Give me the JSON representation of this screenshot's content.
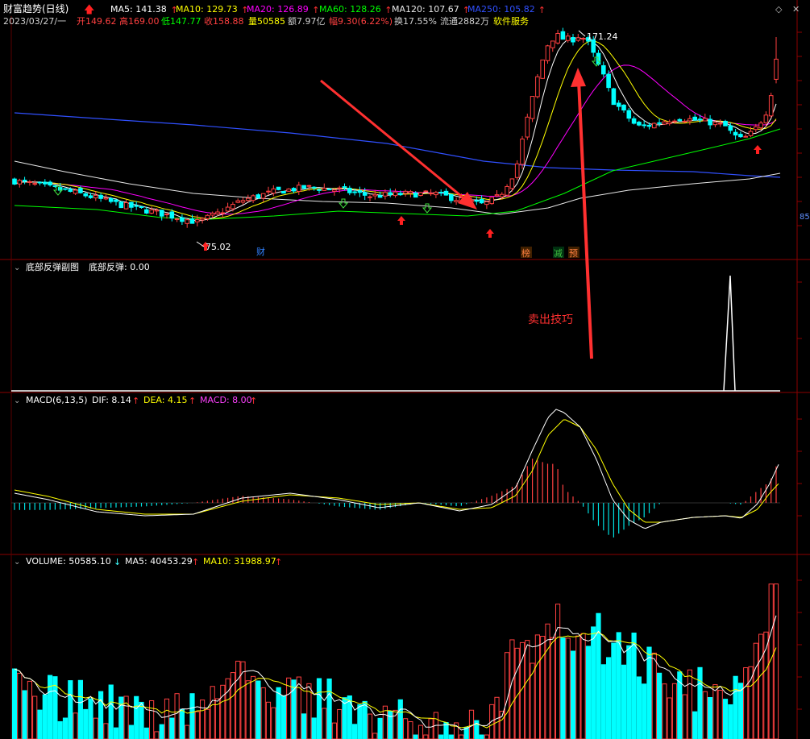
{
  "header": {
    "title": "财富趋势(日线)",
    "ma": [
      {
        "label": "MA5: 141.38",
        "color": "#ffffff"
      },
      {
        "label": "MA10: 129.73",
        "color": "#ffff00"
      },
      {
        "label": "MA20: 126.89",
        "color": "#ff00ff"
      },
      {
        "label": "MA60: 128.26",
        "color": "#00ff00"
      },
      {
        "label": "MA120: 107.67",
        "color": "#e8e8e8"
      },
      {
        "label": "MA250: 105.82",
        "color": "#3050ff"
      }
    ],
    "quote": [
      {
        "text": "2023/03/27/一",
        "color": "#d0d0d0"
      },
      {
        "text": "开149.62",
        "color": "#ff4040"
      },
      {
        "text": "高169.00",
        "color": "#ff4040"
      },
      {
        "text": "低147.77",
        "color": "#00ff00"
      },
      {
        "text": "收158.88",
        "color": "#ff4040"
      },
      {
        "text": "量50585",
        "color": "#ffff00"
      },
      {
        "text": "额7.97亿",
        "color": "#d0d0d0"
      },
      {
        "text": "幅9.30(6.22%)",
        "color": "#ff4040"
      },
      {
        "text": "换17.55%",
        "color": "#d0d0d0"
      },
      {
        "text": "流通2882万",
        "color": "#d0d0d0"
      },
      {
        "text": "软件服务",
        "color": "#ffff00"
      }
    ]
  },
  "annotations": {
    "high_label": "171.24",
    "low_label": "75.02",
    "right_price": "85",
    "sell_label": "卖出技巧",
    "markers": [
      {
        "text": "财",
        "color": "#3080ff"
      },
      {
        "text": "榜",
        "color": "#ff8040"
      },
      {
        "text": "减",
        "color": "#40c040"
      },
      {
        "text": "预",
        "color": "#ff8040"
      }
    ]
  },
  "indicator_panel": {
    "title": "底部反弹副图",
    "value": "底部反弹: 0.00"
  },
  "macd_panel": {
    "title": "MACD(6,13,5)",
    "dif": "DIF: 8.14",
    "dea": "DEA: 4.15",
    "macd": "MACD: 8.00"
  },
  "volume_panel": {
    "volume": "VOLUME: 50585.10",
    "ma5": "MA5: 40453.29",
    "ma10": "MA10: 31988.97"
  },
  "colors": {
    "up": "#ff4040",
    "down": "#00ffff",
    "grid": "#8b0000",
    "ma5": "#ffffff",
    "ma10": "#ffff00",
    "ma20": "#ff00ff",
    "ma60": "#00ff00",
    "ma120": "#e8e8e8",
    "ma250": "#3050ff",
    "arrow": "#ff3030"
  },
  "chart_data": {
    "type": "candlestick",
    "symbol": "财富趋势",
    "period": "日线",
    "last_bar": {
      "date": "2023/03/27",
      "open": 149.62,
      "high": 169.0,
      "low": 147.77,
      "close": 158.88,
      "volume": 50585
    },
    "extremes": {
      "high": 171.24,
      "low": 75.02
    },
    "indicators": {
      "MA5": 141.38,
      "MA10": 129.73,
      "MA20": 126.89,
      "MA60": 128.26,
      "MA120": 107.67,
      "MA250": 105.82,
      "DIF": 8.14,
      "DEA": 4.15,
      "MACD": 8.0,
      "VOLUME": 50585.1,
      "VOL_MA5": 40453.29,
      "VOL_MA10": 31988.97,
      "底部反弹": 0.0
    }
  }
}
